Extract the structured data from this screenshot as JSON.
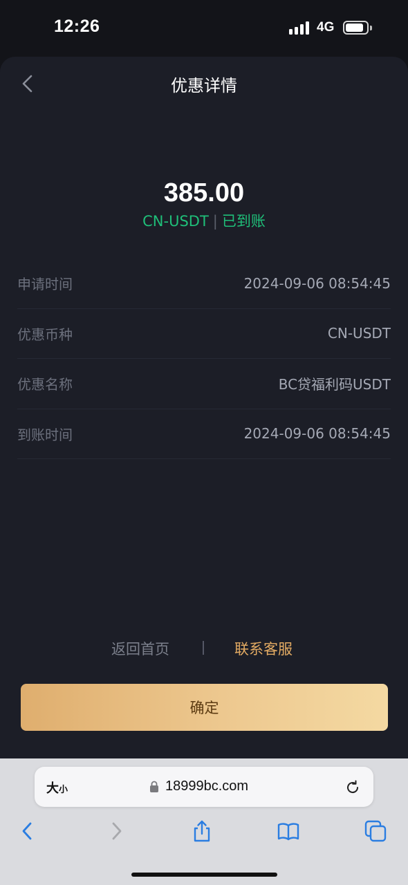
{
  "status_bar": {
    "time": "12:26",
    "network": "4G"
  },
  "header": {
    "title": "优惠详情"
  },
  "summary": {
    "amount": "385.00",
    "currency": "CN-USDT",
    "separator": "|",
    "status": "已到账",
    "status_color": "#1fbf79"
  },
  "details": [
    {
      "label": "申请时间",
      "value": "2024-09-06 08:54:45"
    },
    {
      "label": "优惠币种",
      "value": "CN-USDT"
    },
    {
      "label": "优惠名称",
      "value": "BC贷福利码USDT"
    },
    {
      "label": "到账时间",
      "value": "2024-09-06 08:54:45"
    }
  ],
  "actions": {
    "home_link": "返回首页",
    "support_link": "联系客服",
    "confirm_button": "确定",
    "accent_color": "#e3ab63"
  },
  "browser": {
    "text_size_big": "大",
    "text_size_small": "小",
    "url": "18999bc.com",
    "toolbar_icons": [
      "back-icon",
      "forward-icon",
      "share-icon",
      "bookmarks-icon",
      "tabs-icon"
    ]
  }
}
